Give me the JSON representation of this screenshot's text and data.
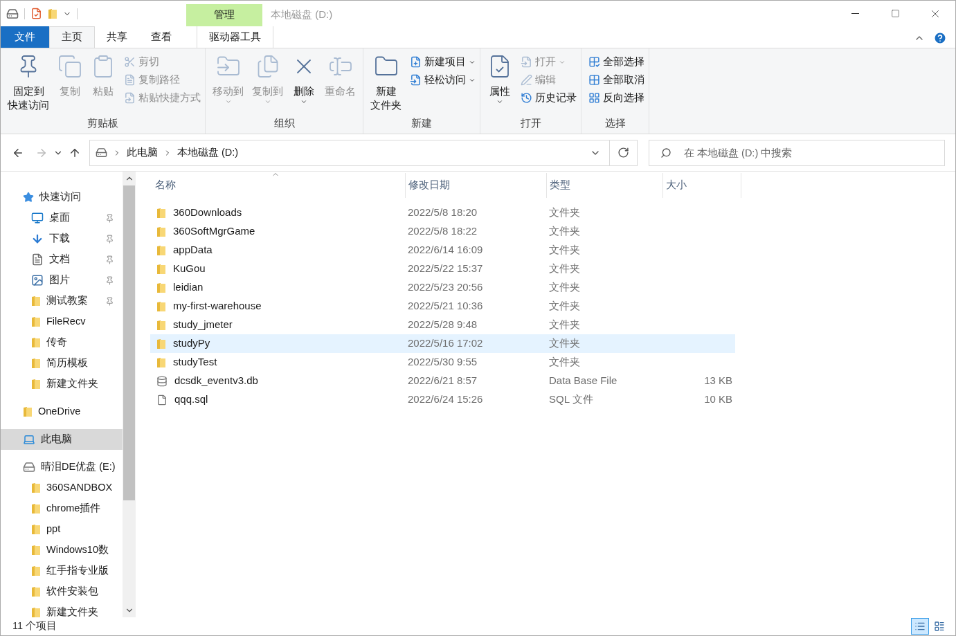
{
  "window": {
    "title": "本地磁盘 (D:)",
    "contextual_group": "管理"
  },
  "ribbon_tabs": [
    {
      "label": "文件",
      "kind": "file",
      "selected": false
    },
    {
      "label": "主页",
      "kind": "normal",
      "selected": true
    },
    {
      "label": "共享",
      "kind": "normal",
      "selected": false
    },
    {
      "label": "查看",
      "kind": "normal",
      "selected": false
    },
    {
      "label": "驱动器工具",
      "kind": "contextual",
      "selected": false
    }
  ],
  "ribbon": {
    "groups": [
      {
        "label": "剪贴板",
        "items": [
          {
            "kind": "large",
            "lines": [
              "固定到",
              "快速访问"
            ],
            "disabled": false,
            "dropdown": false
          },
          {
            "kind": "large",
            "lines": [
              "复制"
            ],
            "disabled": true,
            "dropdown": false
          },
          {
            "kind": "large",
            "lines": [
              "粘贴"
            ],
            "disabled": true,
            "dropdown": false
          },
          {
            "kind": "small",
            "lines": [
              "剪切"
            ],
            "disabled": true,
            "dropdown": false
          },
          {
            "kind": "small",
            "lines": [
              "复制路径"
            ],
            "disabled": true,
            "dropdown": false
          },
          {
            "kind": "small",
            "lines": [
              "粘贴快捷方式"
            ],
            "disabled": true,
            "dropdown": false
          }
        ]
      },
      {
        "label": "组织",
        "items": [
          {
            "kind": "large",
            "lines": [
              "移动到"
            ],
            "disabled": true,
            "dropdown": true
          },
          {
            "kind": "large",
            "lines": [
              "复制到"
            ],
            "disabled": true,
            "dropdown": true
          },
          {
            "kind": "large",
            "lines": [
              "删除"
            ],
            "disabled": false,
            "dropdown": true
          },
          {
            "kind": "large",
            "lines": [
              "重命名"
            ],
            "disabled": true,
            "dropdown": false
          }
        ]
      },
      {
        "label": "新建",
        "items": [
          {
            "kind": "large",
            "lines": [
              "新建",
              "文件夹"
            ],
            "disabled": false,
            "dropdown": false
          },
          {
            "kind": "small",
            "lines": [
              "新建项目"
            ],
            "disabled": false,
            "dropdown": true
          },
          {
            "kind": "small",
            "lines": [
              "轻松访问"
            ],
            "disabled": false,
            "dropdown": true
          }
        ]
      },
      {
        "label": "打开",
        "items": [
          {
            "kind": "large",
            "lines": [
              "属性"
            ],
            "disabled": false,
            "dropdown": true
          },
          {
            "kind": "small",
            "lines": [
              "打开"
            ],
            "disabled": true,
            "dropdown": true
          },
          {
            "kind": "small",
            "lines": [
              "编辑"
            ],
            "disabled": true,
            "dropdown": false
          },
          {
            "kind": "small",
            "lines": [
              "历史记录"
            ],
            "disabled": false,
            "dropdown": false
          }
        ]
      },
      {
        "label": "选择",
        "items": [
          {
            "kind": "small",
            "lines": [
              "全部选择"
            ],
            "disabled": false,
            "dropdown": false
          },
          {
            "kind": "small",
            "lines": [
              "全部取消"
            ],
            "disabled": false,
            "dropdown": false
          },
          {
            "kind": "small",
            "lines": [
              "反向选择"
            ],
            "disabled": false,
            "dropdown": false
          }
        ]
      }
    ]
  },
  "address": {
    "breadcrumbs": [
      "此电脑",
      "本地磁盘 (D:)"
    ]
  },
  "search": {
    "placeholder": "在 本地磁盘 (D:) 中搜索"
  },
  "sidebar": {
    "items": [
      {
        "label": "快速访问",
        "kind": "star",
        "selected": false,
        "children": [
          {
            "label": "桌面",
            "kind": "desktop",
            "pinned": true,
            "selected": false
          },
          {
            "label": "下载",
            "kind": "download",
            "pinned": true,
            "selected": false
          },
          {
            "label": "文档",
            "kind": "document",
            "pinned": true,
            "selected": false
          },
          {
            "label": "图片",
            "kind": "image",
            "pinned": true,
            "selected": false
          },
          {
            "label": "测试教案",
            "kind": "folder",
            "pinned": true,
            "selected": false
          },
          {
            "label": "FileRecv",
            "kind": "folder",
            "pinned": false,
            "selected": false
          },
          {
            "label": "传奇",
            "kind": "folder",
            "pinned": false,
            "selected": false
          },
          {
            "label": "简历模板",
            "kind": "folder",
            "pinned": false,
            "selected": false
          },
          {
            "label": "新建文件夹",
            "kind": "folder",
            "pinned": false,
            "selected": false
          }
        ]
      },
      {
        "label": "OneDrive",
        "kind": "folder",
        "selected": false
      },
      {
        "label": "此电脑",
        "kind": "pc",
        "selected": true
      },
      {
        "label": "晴泪DE优盘 (E:)",
        "kind": "drive",
        "selected": false,
        "children": [
          {
            "label": "360SANDBOX",
            "kind": "folder",
            "pinned": false,
            "selected": false
          },
          {
            "label": "chrome插件",
            "kind": "folder",
            "pinned": false,
            "selected": false
          },
          {
            "label": "ppt",
            "kind": "folder",
            "pinned": false,
            "selected": false
          },
          {
            "label": "Windows10数",
            "kind": "folder",
            "pinned": false,
            "selected": false
          },
          {
            "label": "红手指专业版",
            "kind": "folder",
            "pinned": false,
            "selected": false
          },
          {
            "label": "软件安装包",
            "kind": "folder",
            "pinned": false,
            "selected": false
          },
          {
            "label": "新建文件夹",
            "kind": "folder",
            "pinned": false,
            "selected": false
          }
        ]
      }
    ]
  },
  "table": {
    "columns": [
      "名称",
      "修改日期",
      "类型",
      "大小"
    ],
    "rows": [
      {
        "kind": "folder",
        "name": "360Downloads",
        "date": "2022/5/8 18:20",
        "type": "文件夹",
        "selected": false
      },
      {
        "kind": "folder",
        "name": "360SoftMgrGame",
        "date": "2022/5/8 18:22",
        "type": "文件夹",
        "selected": false
      },
      {
        "kind": "folder",
        "name": "appData",
        "date": "2022/6/14 16:09",
        "type": "文件夹",
        "selected": false
      },
      {
        "kind": "folder",
        "name": "KuGou",
        "date": "2022/5/22 15:37",
        "type": "文件夹",
        "selected": false
      },
      {
        "kind": "folder",
        "name": "leidian",
        "date": "2022/5/23 20:56",
        "type": "文件夹",
        "selected": false
      },
      {
        "kind": "folder",
        "name": "my-first-warehouse",
        "date": "2022/5/21 10:36",
        "type": "文件夹",
        "selected": false
      },
      {
        "kind": "folder",
        "name": "study_jmeter",
        "date": "2022/5/28 9:48",
        "type": "文件夹",
        "selected": false
      },
      {
        "kind": "folder",
        "name": "studyPy",
        "date": "2022/5/16 17:02",
        "type": "文件夹",
        "selected": true
      },
      {
        "kind": "folder",
        "name": "studyTest",
        "date": "2022/5/30 9:55",
        "type": "文件夹",
        "selected": false
      },
      {
        "kind": "database",
        "name": "dcsdk_eventv3.db",
        "date": "2022/6/21 8:57",
        "type": "Data Base File",
        "size": "13 KB",
        "selected": false
      },
      {
        "kind": "file",
        "name": "qqq.sql",
        "date": "2022/6/24 15:26",
        "type": "SQL 文件",
        "size": "10 KB",
        "selected": false
      }
    ]
  },
  "status_bar": {
    "count": "11 个项目",
    "views": [
      {
        "kind": "details",
        "selected": true
      },
      {
        "kind": "large_icons",
        "selected": false
      }
    ]
  }
}
